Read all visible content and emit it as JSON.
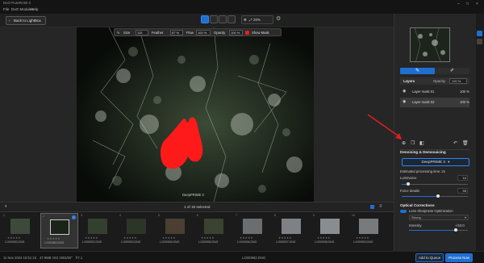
{
  "window": {
    "title": "DxO PureRAW 3",
    "menus": [
      "File",
      "DxO Modules",
      "Help"
    ],
    "controls": [
      "–",
      "□",
      "×"
    ]
  },
  "toolbar": {
    "back_label": "Back to LightBox",
    "zoom_value": "20%"
  },
  "mask_toolbar": {
    "size_label": "Size",
    "size_value": "115",
    "feather_label": "Feather",
    "feather_value": "87 %",
    "flow_label": "Flow",
    "flow_value": "100 %",
    "opacity_label": "Opacity",
    "opacity_value": "100 %",
    "show_mask_label": "Show Mask",
    "mask_color": "#e02020"
  },
  "viewer": {
    "caption": "DeepPRIME 3"
  },
  "filmstrip": {
    "selected_label": "1 of 19 selected",
    "stars": "★★★★★",
    "items": [
      {
        "num": "1",
        "name": "L1000930.DNG"
      },
      {
        "num": "2",
        "name": "L1000983.DNG"
      },
      {
        "num": "3",
        "name": "L1000932.DNG"
      },
      {
        "num": "4",
        "name": "L1000933.DNG"
      },
      {
        "num": "5",
        "name": "L1000934.DNG"
      },
      {
        "num": "6",
        "name": "L1000935.DNG"
      },
      {
        "num": "7",
        "name": "L1000936.DNG"
      },
      {
        "num": "8",
        "name": "L1000937.DNG"
      },
      {
        "num": "9",
        "name": "L1000938.DNG"
      },
      {
        "num": "10",
        "name": "L1000939.DNG"
      }
    ]
  },
  "status": {
    "date": "11 Nov 2024  15:51:15",
    "size": "47.9MB",
    "iso": "ISO 200",
    "shutter": "1/60\"",
    "aperture": "f/7.1",
    "filename": "L1000983.DNG",
    "queue_label": "Add to Queue",
    "process_label": "Process Now"
  },
  "panel": {
    "tools": {
      "brush_icon": "brush-icon",
      "auto_icon": "auto-mask-icon"
    },
    "layers_label": "Layers",
    "opacity_label": "Opacity",
    "opacity_value": "100 %",
    "layers": [
      {
        "name": "Layer mask 01",
        "value": "100 %"
      },
      {
        "name": "Layer mask 02",
        "value": "100 %"
      }
    ],
    "denoise_title": "Denoising & Demosaicing",
    "denoise_method": "DeepPRIME 3",
    "estimated_time": "Estimated processing time: 2s",
    "luminance_label": "Luminance",
    "luminance_value": "10",
    "luminance_fraction": 0.1,
    "force_details_label": "Force details",
    "force_details_value": "55",
    "force_details_fraction": 0.55,
    "optical_title": "Optical Corrections",
    "lso_label": "Lens Sharpness Optimization",
    "strength_value": "Strong",
    "intensity_label": "Intensity",
    "intensity_value": "+/10.0",
    "intensity_fraction": 0.8
  },
  "colors": {
    "accent": "#1f6fd1",
    "annotation": "#e02020"
  }
}
